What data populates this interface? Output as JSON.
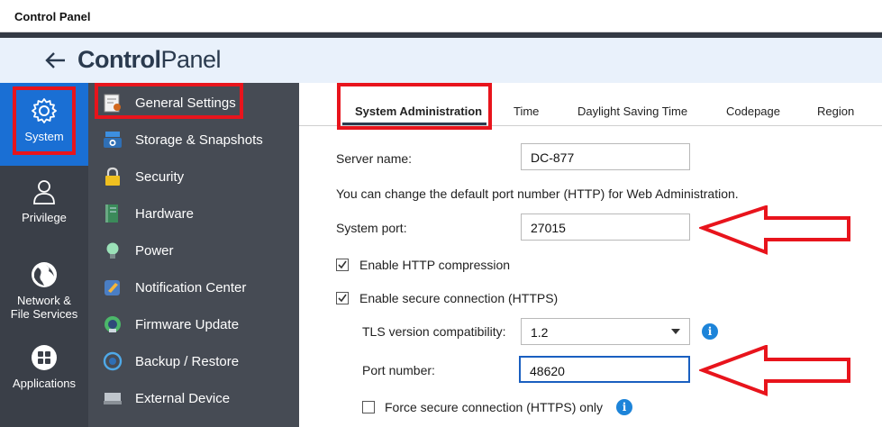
{
  "window": {
    "title": "Control Panel"
  },
  "header": {
    "title_bold": "Control",
    "title_light": "Panel"
  },
  "left_nav": [
    {
      "label": "System"
    },
    {
      "label": "Privilege"
    },
    {
      "label_line1": "Network &",
      "label_line2": "File Services"
    },
    {
      "label": "Applications"
    }
  ],
  "sub_nav": [
    {
      "label": "General Settings",
      "icon": "general-settings-icon"
    },
    {
      "label": "Storage & Snapshots",
      "icon": "storage-icon"
    },
    {
      "label": "Security",
      "icon": "lock-icon"
    },
    {
      "label": "Hardware",
      "icon": "hardware-icon"
    },
    {
      "label": "Power",
      "icon": "power-icon"
    },
    {
      "label": "Notification Center",
      "icon": "notification-icon"
    },
    {
      "label": "Firmware Update",
      "icon": "firmware-icon"
    },
    {
      "label": "Backup / Restore",
      "icon": "backup-icon"
    },
    {
      "label": "External Device",
      "icon": "external-device-icon"
    }
  ],
  "tabs": [
    {
      "label": "System Administration"
    },
    {
      "label": "Time"
    },
    {
      "label": "Daylight Saving Time"
    },
    {
      "label": "Codepage"
    },
    {
      "label": "Region"
    }
  ],
  "form": {
    "server_name_label": "Server name:",
    "server_name_value": "DC-877",
    "port_note": "You can change the default port number (HTTP) for Web Administration.",
    "system_port_label": "System port:",
    "system_port_value": "27015",
    "http_compression_label": "Enable HTTP compression",
    "http_compression_checked": true,
    "secure_connection_label": "Enable secure connection (HTTPS)",
    "secure_connection_checked": true,
    "tls_label": "TLS version compatibility:",
    "tls_value": "1.2",
    "port_number_label": "Port number:",
    "port_number_value": "48620",
    "force_https_label": "Force secure connection (HTTPS) only",
    "force_https_checked": false,
    "info_glyph": "i"
  },
  "colors": {
    "accent": "#1a6fd4",
    "highlight_red": "#e8141c",
    "nav_dark": "#3a3f48",
    "subnav": "#464b54"
  }
}
